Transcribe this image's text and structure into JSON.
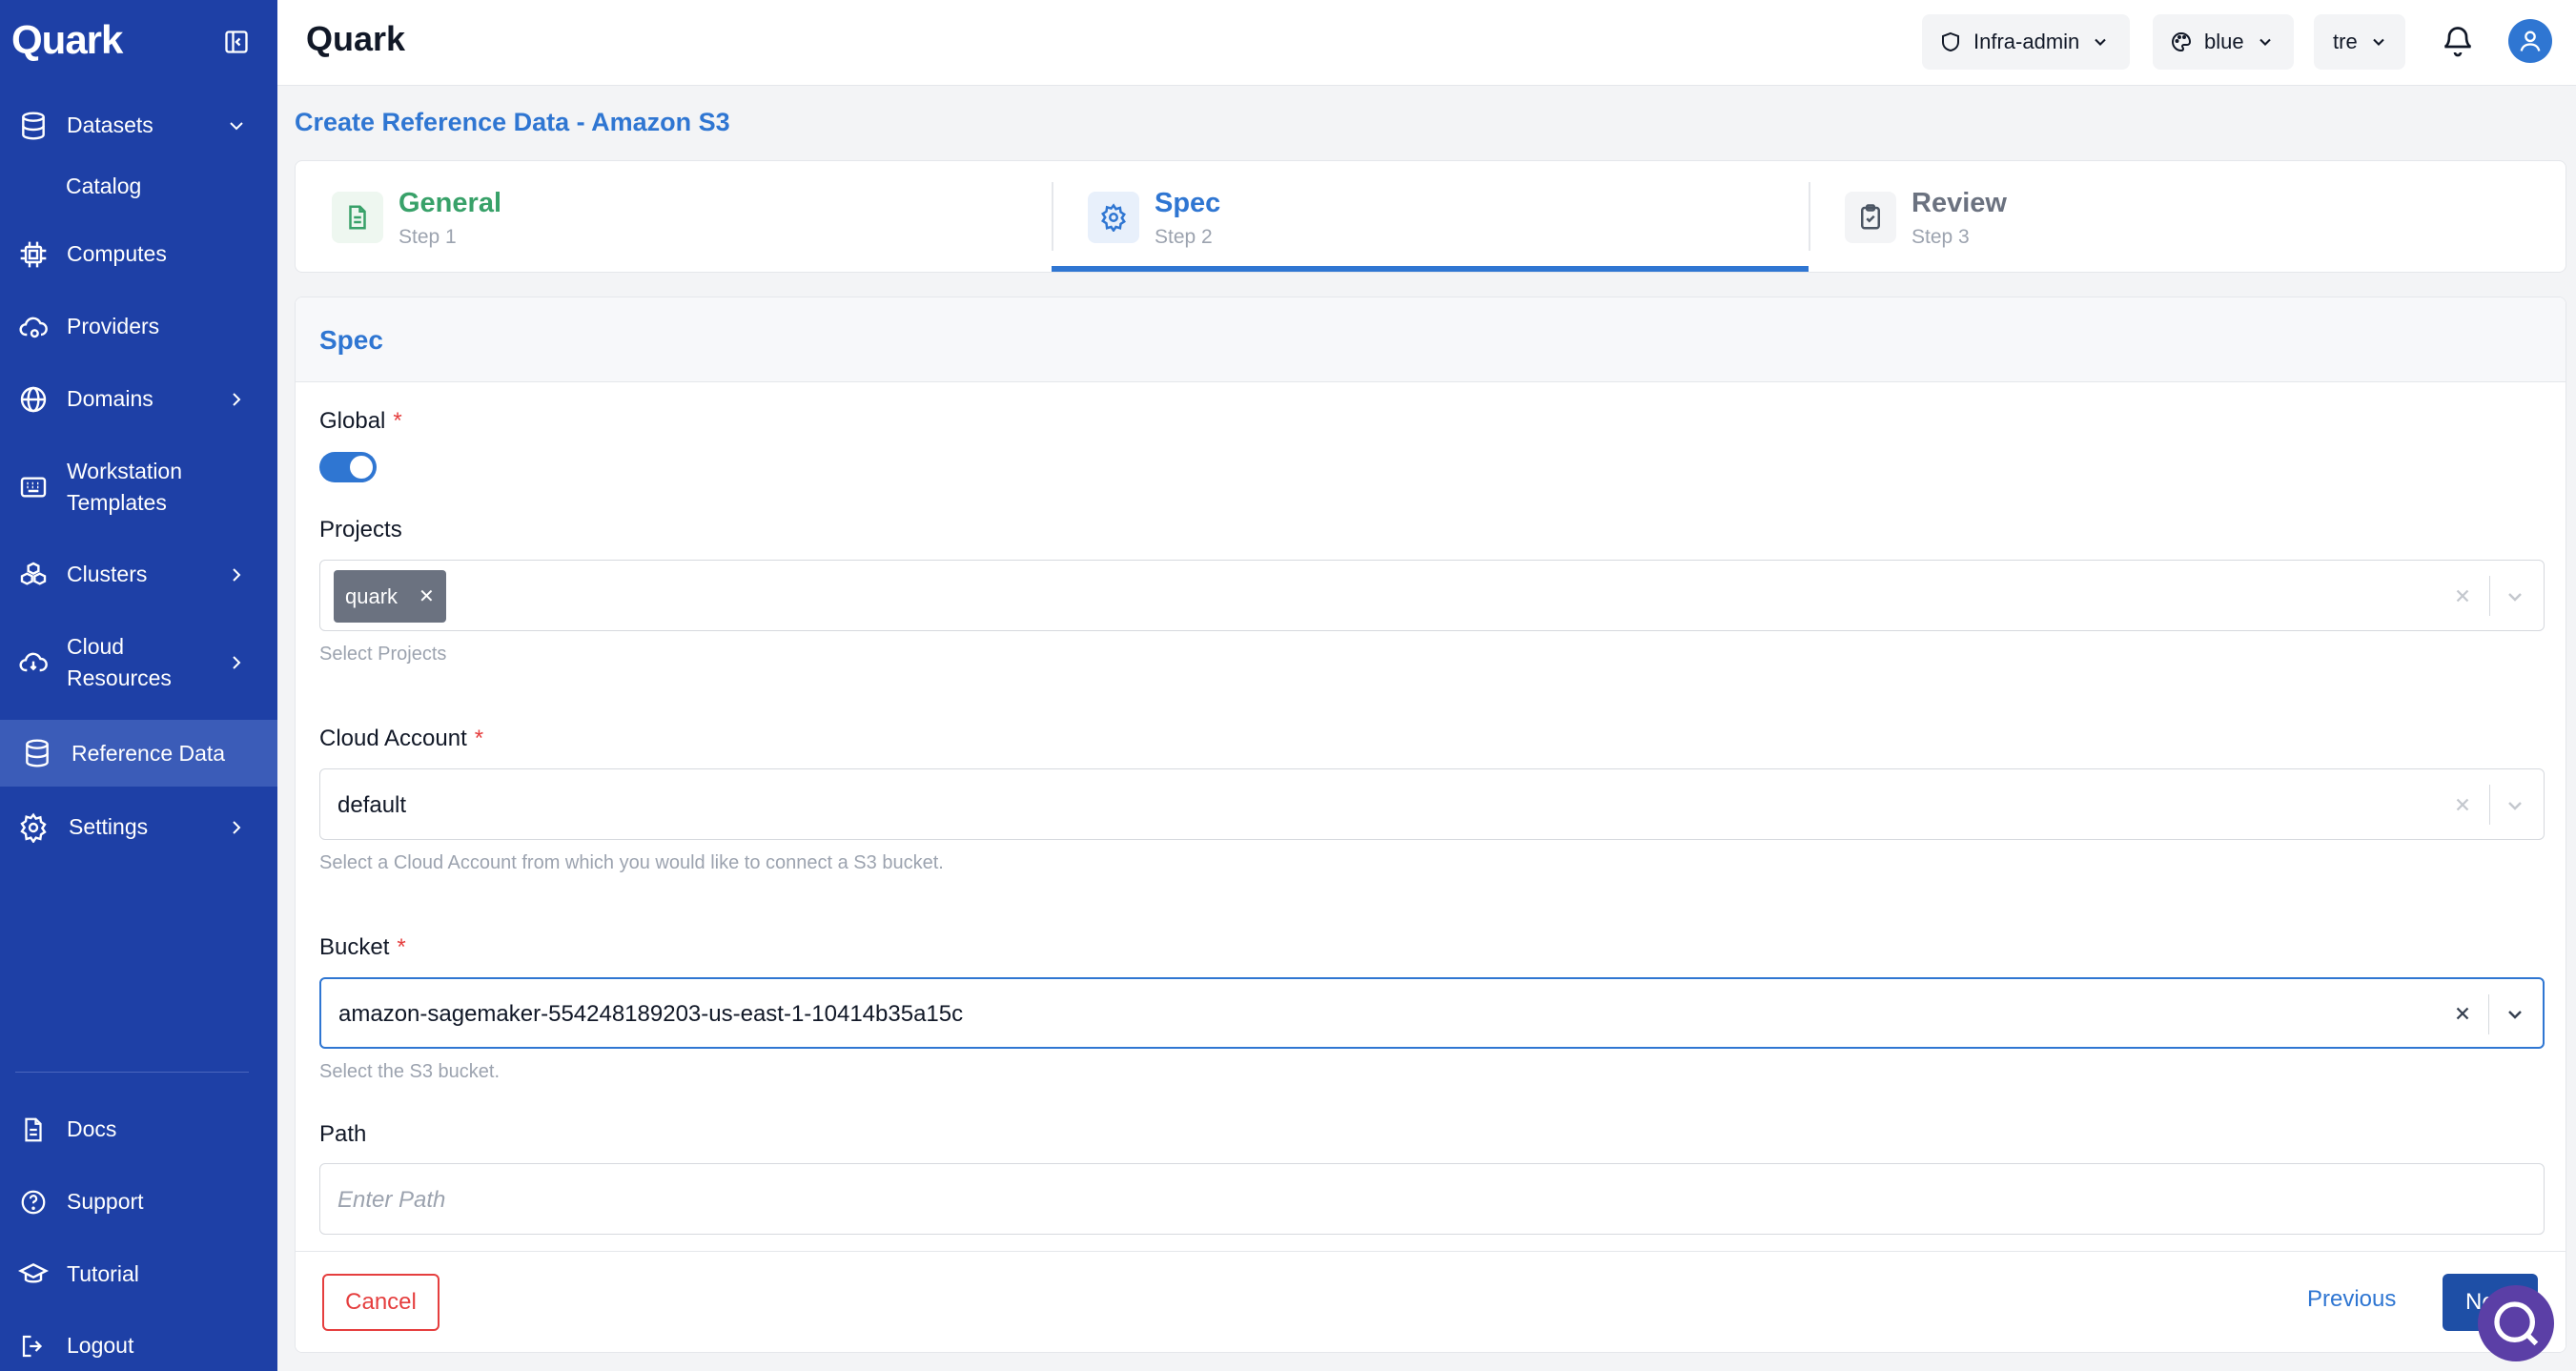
{
  "brand": "Quark",
  "sidebar": {
    "datasets": "Datasets",
    "catalog": "Catalog",
    "computes": "Computes",
    "providers": "Providers",
    "domains": "Domains",
    "workstation_line1": "Workstation",
    "workstation_line2": "Templates",
    "clusters": "Clusters",
    "cloud_line1": "Cloud",
    "cloud_line2": "Resources",
    "reference_data": "Reference Data",
    "settings": "Settings",
    "docs": "Docs",
    "support": "Support",
    "tutorial": "Tutorial",
    "logout": "Logout"
  },
  "header": {
    "title": "Quark",
    "role": "Infra-admin",
    "theme": "blue",
    "tenant": "tre"
  },
  "page_title": "Create Reference Data - Amazon S3",
  "steps": [
    {
      "title": "General",
      "sub": "Step 1"
    },
    {
      "title": "Spec",
      "sub": "Step 2"
    },
    {
      "title": "Review",
      "sub": "Step 3"
    }
  ],
  "form": {
    "section": "Spec",
    "global_label": "Global",
    "global_on": true,
    "projects_label": "Projects",
    "projects_chip": "quark",
    "projects_hint": "Select Projects",
    "cloud_account_label": "Cloud Account",
    "cloud_account_value": "default",
    "cloud_account_hint": "Select a Cloud Account from which you would like to connect a S3 bucket.",
    "bucket_label": "Bucket",
    "bucket_value": "amazon-sagemaker-554248189203-us-east-1-10414b35a15c",
    "bucket_hint": "Select the S3 bucket.",
    "path_label": "Path",
    "path_placeholder": "Enter Path",
    "required_mark": "*"
  },
  "footer": {
    "cancel": "Cancel",
    "previous": "Previous",
    "next": "Next"
  },
  "colors": {
    "sidebar": "#1e40a6",
    "accent": "#2f76d2",
    "success": "#38a169",
    "danger": "#e53e3e"
  }
}
